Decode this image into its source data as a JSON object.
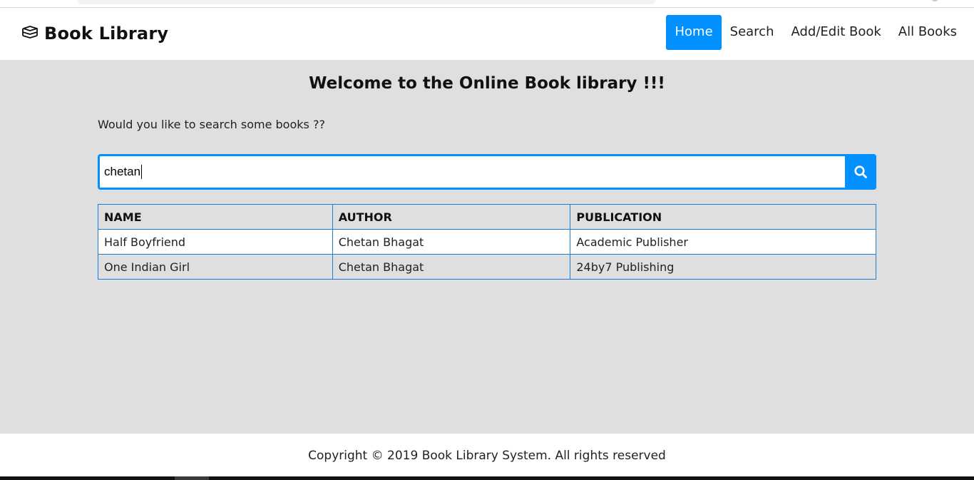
{
  "navbar": {
    "brand": "Book Library",
    "brand_icon": "books-icon",
    "items": [
      {
        "label": "Home",
        "active": true
      },
      {
        "label": "Search",
        "active": false
      },
      {
        "label": "Add/Edit Book",
        "active": false
      },
      {
        "label": "All Books",
        "active": false
      }
    ]
  },
  "main": {
    "welcome": "Welcome to the Online Book library !!!",
    "prompt": "Would you like to search some books ??",
    "search": {
      "value": "chetan",
      "button_icon": "search-icon"
    },
    "table": {
      "headers": [
        "NAME",
        "AUTHOR",
        "PUBLICATION"
      ],
      "rows": [
        [
          "Half Boyfriend",
          "Chetan Bhagat",
          "Academic Publisher"
        ],
        [
          "One Indian Girl",
          "Chetan Bhagat",
          "24by7 Publishing"
        ]
      ]
    }
  },
  "footer": {
    "text": "Copyright © 2019 Book Library System. All rights reserved"
  },
  "colors": {
    "accent": "#0090ff",
    "background": "#dfdfdf",
    "table_border": "#1a7fd4"
  }
}
